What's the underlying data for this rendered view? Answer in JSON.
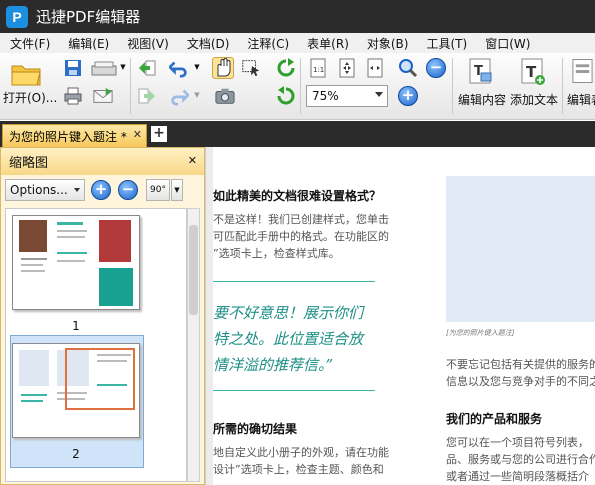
{
  "app": {
    "title": "迅捷PDF编辑器",
    "logo_letter": "P"
  },
  "menu": [
    "文件(F)",
    "编辑(E)",
    "视图(V)",
    "文档(D)",
    "注释(C)",
    "表单(R)",
    "对象(B)",
    "工具(T)",
    "窗口(W)"
  ],
  "toolbar": {
    "open_label": "打开(O)...",
    "zoom_value": "75%",
    "edit_content_label": "编辑内容",
    "add_text_label": "添加文本",
    "edit_form_label": "编辑表"
  },
  "tabs": {
    "document_tab": "为您的照片键入题注 *",
    "new_tab": "+"
  },
  "panel": {
    "title": "缩略图",
    "options_label": "Options...",
    "rotate_label": "90°",
    "pages": [
      {
        "number": "1"
      },
      {
        "number": "2"
      }
    ]
  },
  "document": {
    "heading1": "如此精美的文档很难设置格式？",
    "para1": [
      "不是这样！我们已创建样式，您单击",
      "可匹配此手册中的格式。在功能区的",
      "”选项卡上，检查样式库。"
    ],
    "quote": [
      "要不好意思！展示你们",
      "特之处。此位置适合放",
      "情洋溢的推荐信。”"
    ],
    "heading2": "所需的确切结果",
    "para2": [
      "地自定义此小册子的外观，请在功能",
      "设计”选项卡上，检查主题、颜色和"
    ],
    "caption": "[为您的照片键入题注]",
    "right_para": [
      "不要忘记包括有关提供的服务的",
      "信息以及您与竞争对手的不同之处"
    ],
    "right_heading": "我们的产品和服务",
    "right_para2": [
      "您可以在一个项目符号列表，",
      "品、服务或与您的公司进行合作的",
      "或者通过一些简明段落概括介"
    ]
  },
  "colors": {
    "accent_teal": "#1d8f85",
    "tab_gold": "#f6c85b",
    "titlebar": "#2b2b2b"
  }
}
